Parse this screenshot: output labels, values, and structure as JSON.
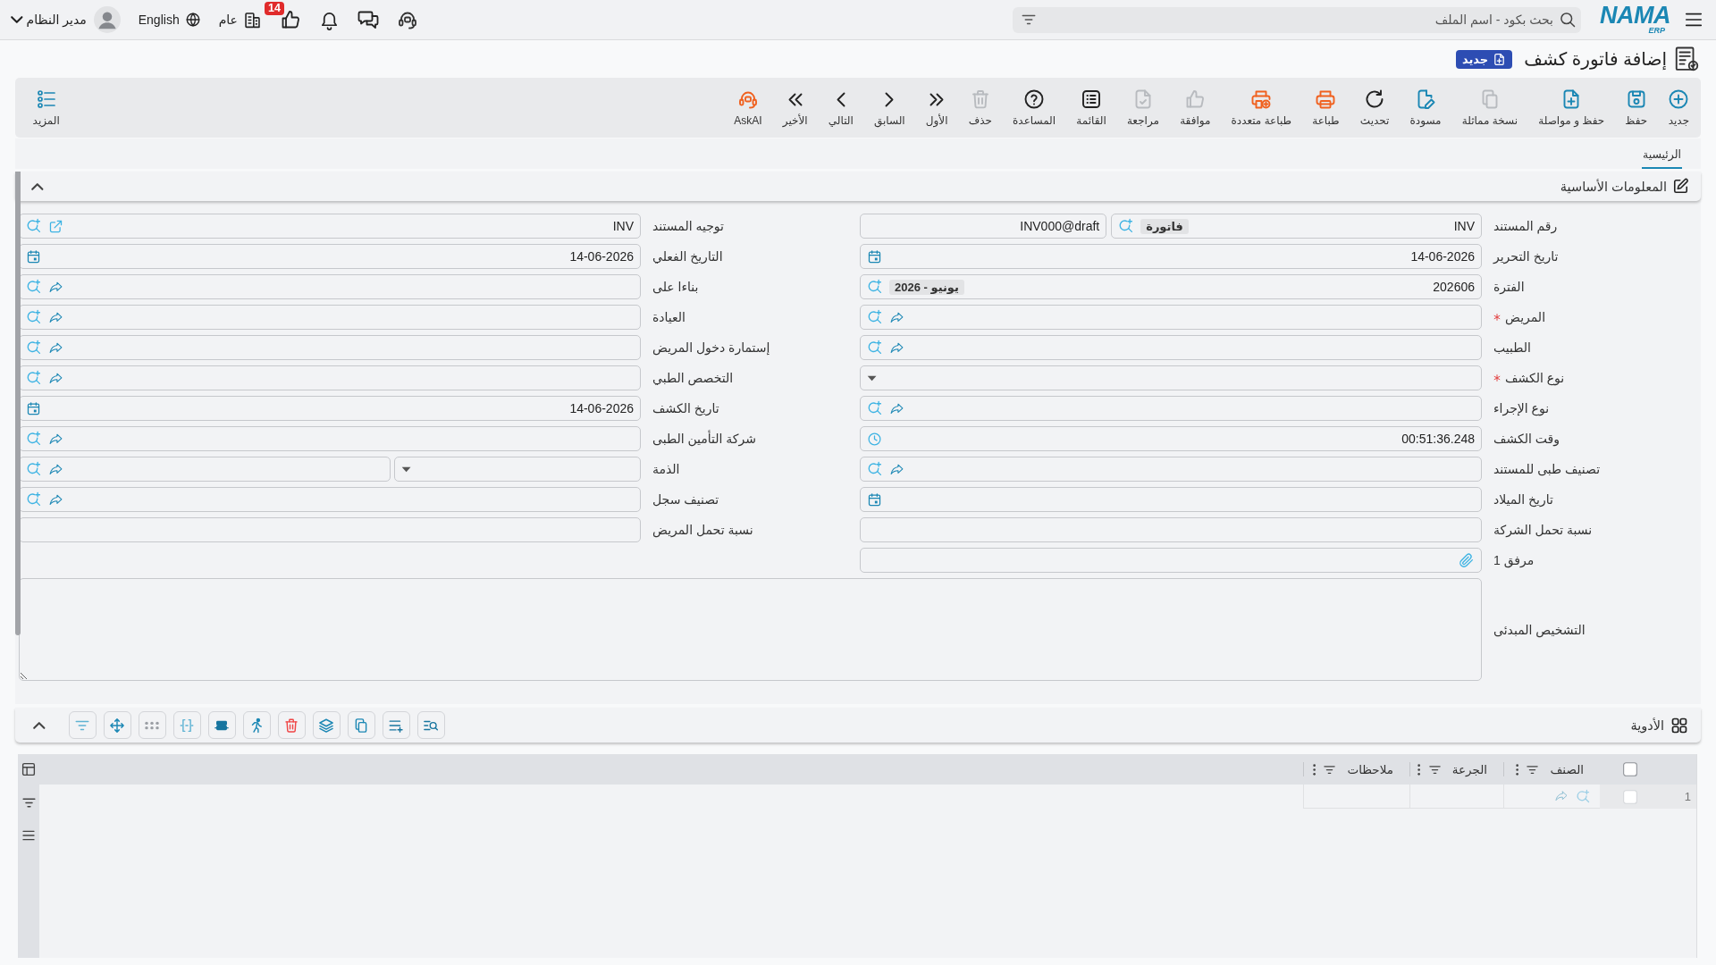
{
  "top_bar": {
    "logo": {
      "name": "NAMA",
      "tagline": "ERP"
    },
    "search": {
      "placeholder": "بحث بكود - اسم الملف"
    },
    "notifications_badge": "14",
    "company": "عام",
    "language": "English",
    "user": "مدير النظام"
  },
  "page": {
    "title": "إضافة فاتورة كشف",
    "status": "جديد"
  },
  "toolbar": {
    "buttons": [
      {
        "kind": "new",
        "label": "جديد",
        "disabled": false
      },
      {
        "kind": "save",
        "label": "حفظ",
        "disabled": false
      },
      {
        "kind": "save_continue",
        "label": "حفظ و مواصلة",
        "disabled": false
      },
      {
        "kind": "duplicate",
        "label": "نسخة مماثلة",
        "disabled": true
      },
      {
        "kind": "draft",
        "label": "مسودة",
        "disabled": false
      },
      {
        "kind": "refresh",
        "label": "تحديث",
        "disabled": false
      },
      {
        "kind": "print",
        "label": "طباعة",
        "disabled": false
      },
      {
        "kind": "print_multiple",
        "label": "طباعة متعددة",
        "disabled": false
      },
      {
        "kind": "approve",
        "label": "موافقة",
        "disabled": true
      },
      {
        "kind": "review",
        "label": "مراجعة",
        "disabled": true
      },
      {
        "kind": "list",
        "label": "القائمة",
        "disabled": false
      },
      {
        "kind": "help",
        "label": "المساعدة",
        "disabled": false
      },
      {
        "kind": "delete",
        "label": "حذف",
        "disabled": true
      },
      {
        "kind": "first",
        "label": "الأول",
        "disabled": false
      },
      {
        "kind": "previous",
        "label": "السابق",
        "disabled": false
      },
      {
        "kind": "next",
        "label": "التالي",
        "disabled": false
      },
      {
        "kind": "last",
        "label": "الأخير",
        "disabled": false
      },
      {
        "kind": "ask_ai",
        "label": "AskAI",
        "disabled": false
      }
    ],
    "more": {
      "label": "المزيد"
    }
  },
  "tabs": [
    {
      "label": "الرئيسية",
      "selected": true
    }
  ],
  "basic_info": {
    "title": "المعلومات الأساسية",
    "expanded": true,
    "fields": [
      {
        "label": "رقم المستند",
        "kind": "doc_number",
        "required": false,
        "value": "INV",
        "tag": "فاتورة",
        "code": "INV000@draft"
      },
      {
        "label": "توجيه المستند",
        "kind": "reference",
        "required": false,
        "value": "INV"
      },
      {
        "label": "تاريخ التحرير",
        "kind": "date",
        "required": false,
        "value": "14-06-2026"
      },
      {
        "label": "التاريخ الفعلي",
        "kind": "date",
        "required": false,
        "value": "14-06-2026"
      },
      {
        "label": "الفترة",
        "kind": "coded",
        "required": false,
        "value": "202606",
        "tag": "يونيو - 2026"
      },
      {
        "label": "بناءا على",
        "kind": "lookup",
        "required": false
      },
      {
        "label": "المريض",
        "kind": "lookup",
        "required": true
      },
      {
        "label": "العيادة",
        "kind": "lookup",
        "required": false
      },
      {
        "label": "الطبيب",
        "kind": "lookup",
        "required": false
      },
      {
        "label": "إستمارة دخول المريض",
        "kind": "lookup",
        "required": false
      },
      {
        "label": "نوع الكشف",
        "kind": "select",
        "required": true
      },
      {
        "label": "التخصص الطبي",
        "kind": "lookup",
        "required": false
      },
      {
        "label": "نوع الإجراء",
        "kind": "lookup",
        "required": false
      },
      {
        "label": "تاريخ الكشف",
        "kind": "date",
        "required": false,
        "value": "14-06-2026"
      },
      {
        "label": "وقت الكشف",
        "kind": "time",
        "required": false,
        "value": "00:51:36.248"
      },
      {
        "label": "شركة التأمين الطبى",
        "kind": "lookup",
        "required": false
      },
      {
        "label": "تصنيف طبى للمستند",
        "kind": "lookup",
        "required": false
      },
      {
        "label": "الذمة",
        "kind": "split",
        "required": false
      },
      {
        "label": "تاريخ الميلاد",
        "kind": "date",
        "required": false
      },
      {
        "label": "تصنيف سجل",
        "kind": "lookup",
        "required": false
      },
      {
        "label": "نسبة تحمل الشركة",
        "kind": "text",
        "required": false
      },
      {
        "label": "نسبة تحمل المريض",
        "kind": "text",
        "required": false
      },
      {
        "label": "مرفق 1",
        "kind": "file",
        "required": false
      }
    ],
    "diagnosis": {
      "label": "التشخيص المبدئى"
    }
  },
  "medicines": {
    "title": "الأدوية",
    "expanded": true,
    "tools": [
      {
        "kind": "find_line"
      },
      {
        "kind": "add_line"
      },
      {
        "kind": "copy"
      },
      {
        "kind": "layers"
      },
      {
        "kind": "delete"
      },
      {
        "kind": "run"
      },
      {
        "kind": "table_row"
      },
      {
        "kind": "fit"
      },
      {
        "kind": "dots"
      },
      {
        "kind": "move"
      },
      {
        "kind": "filter"
      }
    ],
    "table": {
      "all_checked": false,
      "columns": [
        {
          "label": "الصنف"
        },
        {
          "label": "الجرعة"
        },
        {
          "label": "ملاحظات"
        }
      ],
      "rows": [
        {
          "number": "1",
          "checked": false
        }
      ]
    }
  }
}
